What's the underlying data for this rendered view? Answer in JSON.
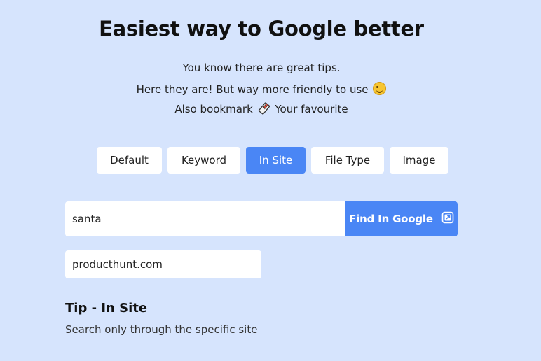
{
  "header": {
    "title": "Easiest way to Google better",
    "line1": "You know there are great tips.",
    "line2": "Here they are! But way more friendly to use",
    "line2_icon": "winking-face-emoji-icon",
    "line3_prefix": "Also bookmark",
    "line3_icon": "bookmark-icon",
    "line3_suffix": "Your favourite"
  },
  "tabs": [
    {
      "label": "Default",
      "active": false
    },
    {
      "label": "Keyword",
      "active": false
    },
    {
      "label": "In Site",
      "active": true
    },
    {
      "label": "File Type",
      "active": false
    },
    {
      "label": "Image",
      "active": false
    }
  ],
  "search": {
    "value": "santa",
    "button_label": "Find In Google",
    "button_icon": "external-link-icon"
  },
  "site": {
    "value": "producthunt.com"
  },
  "tip": {
    "title": "Tip - In Site",
    "description": "Search only through the specific site"
  },
  "colors": {
    "background": "#d6e4fd",
    "accent": "#4a86f5"
  }
}
